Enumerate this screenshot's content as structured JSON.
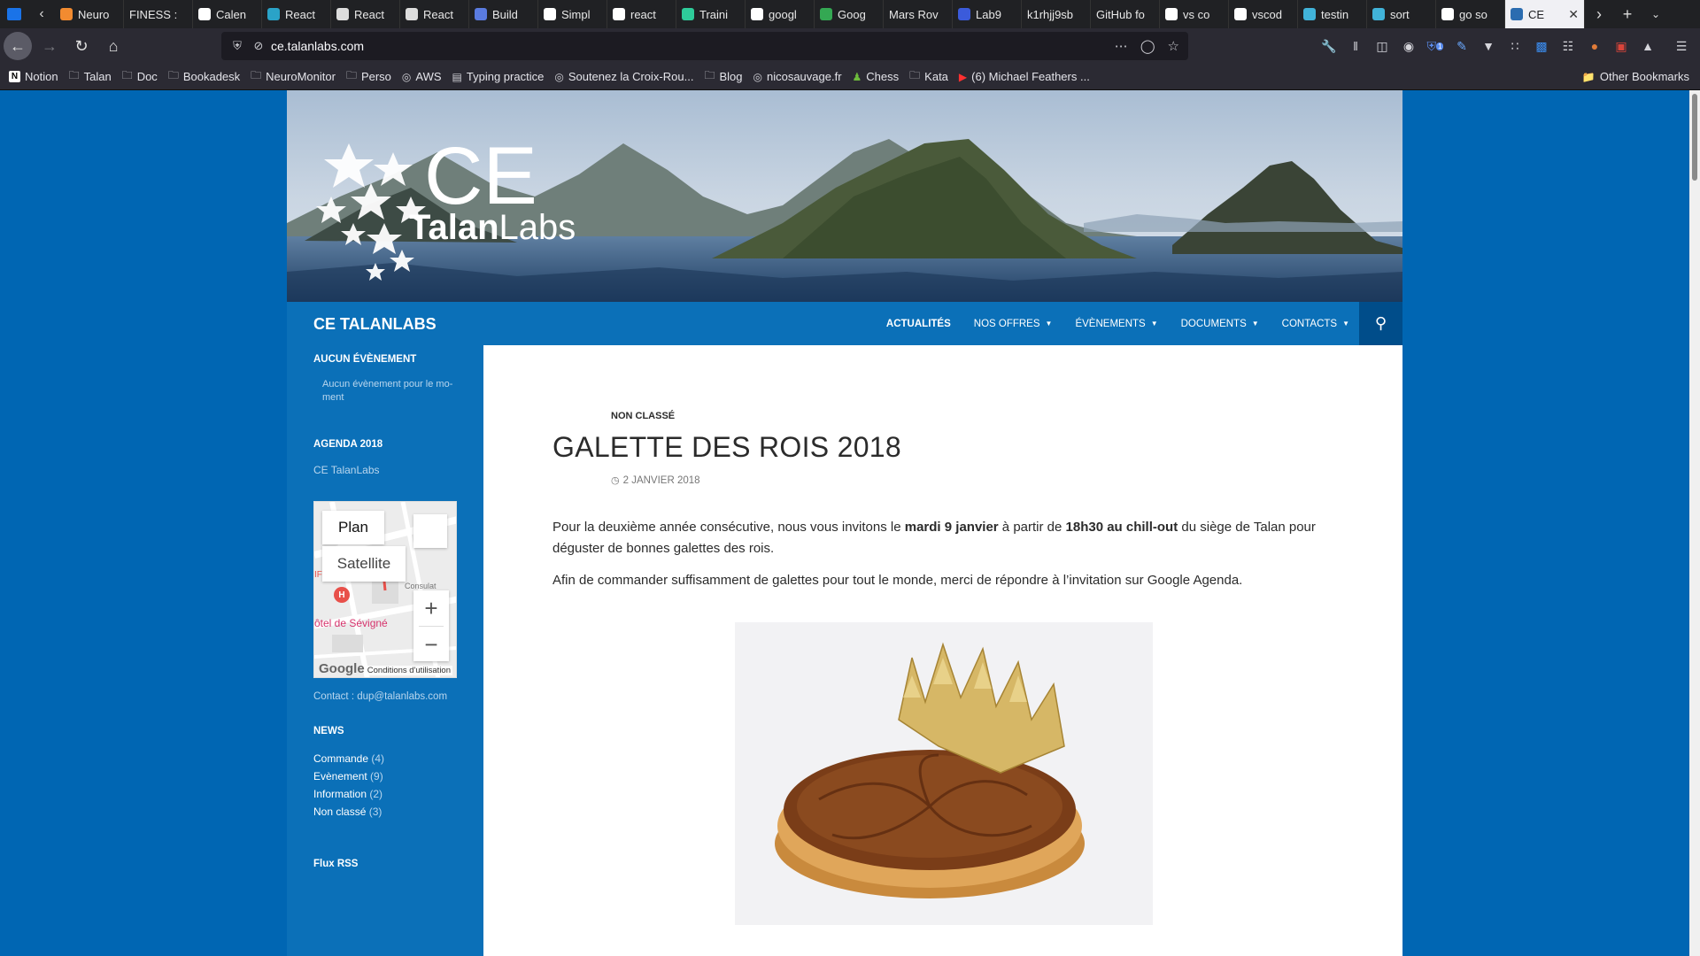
{
  "browser": {
    "tabs": [
      {
        "label": "Neuro",
        "color": "#f28b30"
      },
      {
        "label": "FINESS :",
        "color": ""
      },
      {
        "label": "Calen",
        "color": "#ffffff"
      },
      {
        "label": "React",
        "color": "#2aa3c8"
      },
      {
        "label": "React",
        "color": "#dddddd"
      },
      {
        "label": "React",
        "color": "#dddddd"
      },
      {
        "label": "Build",
        "color": "#5a7be0"
      },
      {
        "label": "Simpl",
        "color": "#ffffff"
      },
      {
        "label": "react",
        "color": "#ffffff"
      },
      {
        "label": "Traini",
        "color": "#2ecc9a"
      },
      {
        "label": "googl",
        "color": "#ffffff"
      },
      {
        "label": "Goog",
        "color": "#34a853"
      },
      {
        "label": "Mars Rov",
        "color": ""
      },
      {
        "label": "Lab9",
        "color": "#3b5bdb"
      },
      {
        "label": "k1rhjj9sb",
        "color": ""
      },
      {
        "label": "GitHub fo",
        "color": ""
      },
      {
        "label": "vs co",
        "color": "#ffffff"
      },
      {
        "label": "vscod",
        "color": "#ffffff"
      },
      {
        "label": "testin",
        "color": "#41b3d9"
      },
      {
        "label": "sort",
        "color": "#41b3d9"
      },
      {
        "label": "go so",
        "color": "#ffffff"
      }
    ],
    "active_tab": {
      "label": "CE",
      "color": "#2b6cb0"
    },
    "url": "ce.talanlabs.com",
    "bookmarks": [
      {
        "label": "Notion",
        "icon": "notion-icon"
      },
      {
        "label": "Talan",
        "icon": "folder-icon"
      },
      {
        "label": "Doc",
        "icon": "folder-icon"
      },
      {
        "label": "Bookadesk",
        "icon": "folder-icon"
      },
      {
        "label": "NeuroMonitor",
        "icon": "folder-icon"
      },
      {
        "label": "Perso",
        "icon": "folder-icon"
      },
      {
        "label": "AWS",
        "icon": "globe-icon"
      },
      {
        "label": "Typing practice",
        "icon": "page-icon"
      },
      {
        "label": "Soutenez la Croix-Rou...",
        "icon": "globe-icon"
      },
      {
        "label": "Blog",
        "icon": "folder-icon"
      },
      {
        "label": "nicosauvage.fr",
        "icon": "globe-icon"
      },
      {
        "label": "Chess",
        "icon": "chess-icon"
      },
      {
        "label": "Kata",
        "icon": "folder-icon"
      },
      {
        "label": "(6) Michael Feathers ...",
        "icon": "youtube-icon"
      }
    ],
    "other_bookmarks": "Other Bookmarks",
    "badge_count": "1"
  },
  "site": {
    "title": "CE TALANLABS",
    "logo": {
      "big": "CE",
      "brand1": "Talan",
      "brand2": "Labs"
    },
    "menu": [
      {
        "label": "ACTUALITÉS",
        "current": true,
        "dropdown": false
      },
      {
        "label": "NOS OFFRES",
        "current": false,
        "dropdown": true
      },
      {
        "label": "ÉVÈNEMENTS",
        "current": false,
        "dropdown": true
      },
      {
        "label": "DOCUMENTS",
        "current": false,
        "dropdown": true
      },
      {
        "label": "CONTACTS",
        "current": false,
        "dropdown": true
      }
    ]
  },
  "sidebar": {
    "events_title": "AUCUN ÉVÈNEMENT",
    "events_text_1": "Aucun évènement pour le mo-",
    "events_text_2": "ment",
    "agenda_title": "AGENDA 2018",
    "agenda_link": "CE TalanLabs",
    "map": {
      "plan": "Plan",
      "satellite": "Satellite",
      "place": "ôtel de Sévigné",
      "street": "Consulat",
      "corner": "IF",
      "pin": "H",
      "google": "Google",
      "terms": "Conditions d'utilisation"
    },
    "contact": "Contact : dup@talanlabs.com",
    "news_title": "NEWS",
    "news": [
      {
        "label": "Commande",
        "count": "(4)"
      },
      {
        "label": "Evènement",
        "count": "(9)"
      },
      {
        "label": "Information",
        "count": "(2)"
      },
      {
        "label": "Non classé",
        "count": "(3)"
      }
    ],
    "rss": "Flux RSS"
  },
  "post": {
    "category": "NON CLASSÉ",
    "title": "GALETTE DES ROIS 2018",
    "date": "2 JANVIER 2018",
    "p1_a": "Pour la deuxième année consécutive, nous vous invitons le ",
    "p1_b": "mardi 9 janvier",
    "p1_c": " à partir de ",
    "p1_d": "18h30 au chill-out",
    "p1_e": " du siège de Talan pour",
    "p1_f": "déguster de bonnes galettes des rois.",
    "p2": "Afin de commander suffisamment de galettes pour tout le monde, merci de répondre à l’invitation sur Google Agenda."
  }
}
